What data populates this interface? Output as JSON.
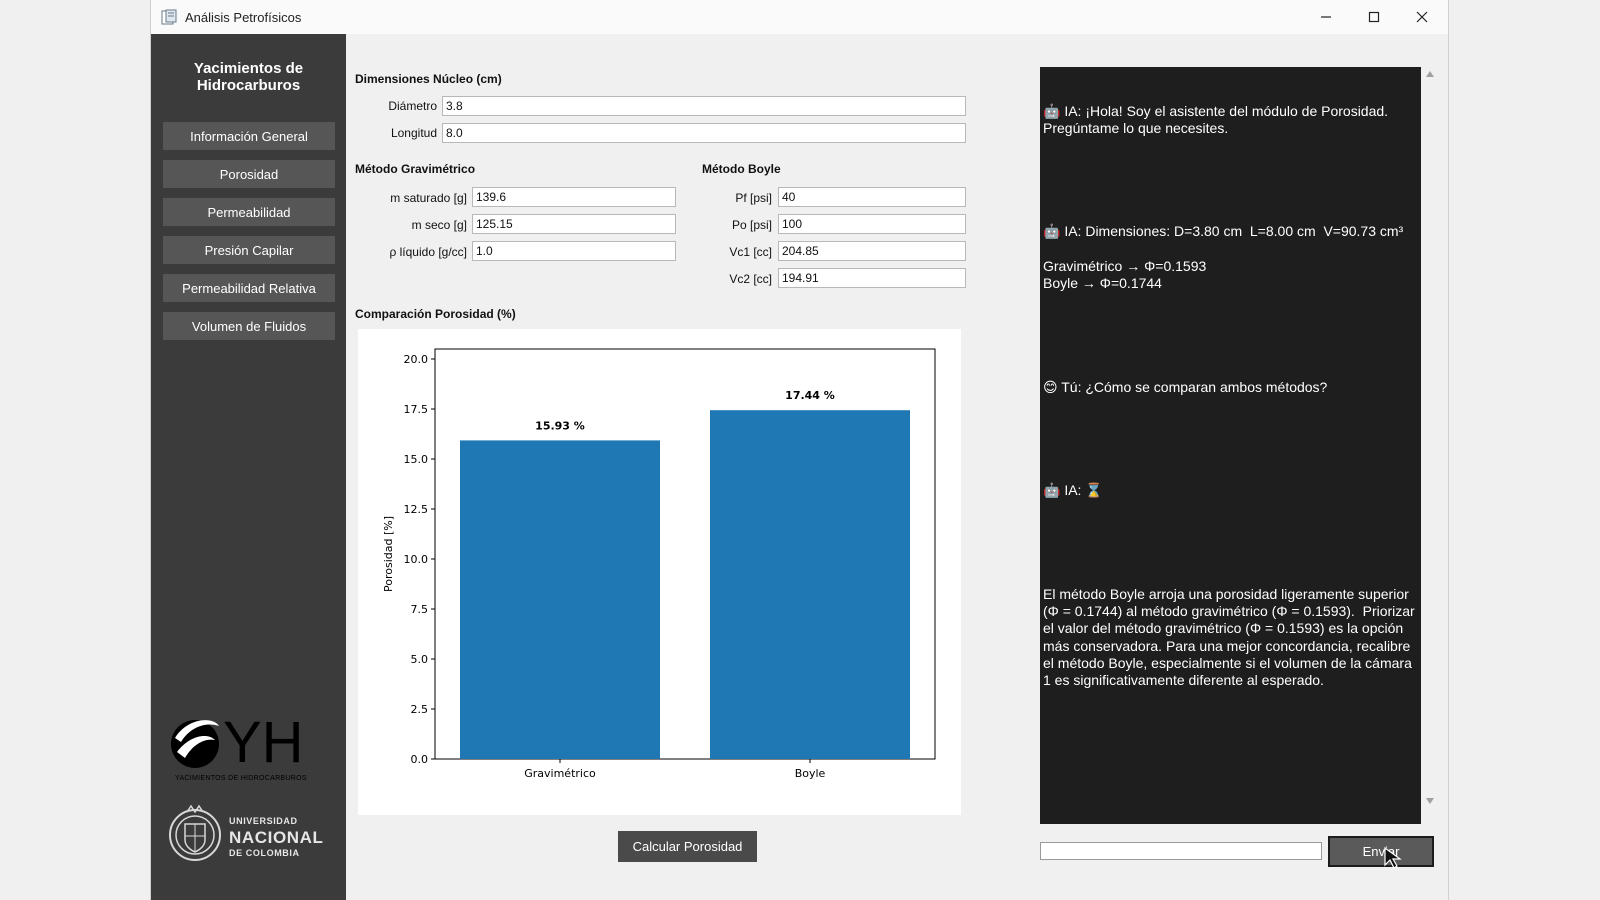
{
  "window": {
    "title": "Análisis Petrofísicos"
  },
  "sidebar": {
    "title_line1": "Yacimientos de",
    "title_line2": "Hidrocarburos",
    "items": [
      {
        "label": "Información General"
      },
      {
        "label": "Porosidad"
      },
      {
        "label": "Permeabilidad"
      },
      {
        "label": "Presión Capilar"
      },
      {
        "label": "Permeabilidad Relativa"
      },
      {
        "label": "Volumen de Fluidos"
      }
    ],
    "logo_yh": {
      "text": "YH",
      "caption": "YACIMIENTOS DE HIDROCARBUROS"
    },
    "logo_unal": {
      "line1": "UNIVERSIDAD",
      "line2": "NACIONAL",
      "line3": "DE COLOMBIA"
    }
  },
  "core": {
    "title": "Dimensiones Núcleo (cm)",
    "diameter_label": "Diámetro",
    "diameter_value": "3.8",
    "length_label": "Longitud",
    "length_value": "8.0"
  },
  "gravimetric": {
    "title": "Método Gravimétrico",
    "fields": [
      {
        "label": "m saturado [g]",
        "value": "139.6"
      },
      {
        "label": "m seco [g]",
        "value": "125.15"
      },
      {
        "label": "ρ líquido [g/cc]",
        "value": "1.0"
      }
    ]
  },
  "boyle": {
    "title": "Método Boyle",
    "fields": [
      {
        "label": "Pf [psi]",
        "value": "40"
      },
      {
        "label": "Po [psi]",
        "value": "100"
      },
      {
        "label": "Vc1 [cc]",
        "value": "204.85"
      },
      {
        "label": "Vc2 [cc]",
        "value": "194.91"
      }
    ]
  },
  "chart_section_title": "Comparación Porosidad (%)",
  "chart_data": {
    "type": "bar",
    "categories": [
      "Gravimétrico",
      "Boyle"
    ],
    "values": [
      15.93,
      17.44
    ],
    "data_labels": [
      "15.93 %",
      "17.44 %"
    ],
    "title": "",
    "xlabel": "",
    "ylabel": "Porosidad [%]",
    "ylim": [
      0,
      20.5
    ],
    "yticks": [
      "0.0",
      "2.5",
      "5.0",
      "7.5",
      "10.0",
      "12.5",
      "15.0",
      "17.5",
      "20.0"
    ],
    "grid": false,
    "bar_color": "#1f77b4"
  },
  "calculate_button": "Calcular Porosidad",
  "chat": {
    "messages": [
      {
        "text": "🤖 IA: ¡Hola! Soy el asistente del módulo de Porosidad. Pregúntame lo que necesites."
      },
      {
        "text": "🤖 IA: Dimensiones: D=3.80 cm  L=8.00 cm  V=90.73 cm³\n\nGravimétrico → Φ=0.1593\nBoyle → Φ=0.1744"
      },
      {
        "text": "😊 Tú: ¿Cómo se comparan ambos métodos?"
      },
      {
        "text": "🤖 IA: ⌛"
      },
      {
        "text": "El método Boyle arroja una porosidad ligeramente superior (Φ = 0.1744) al método gravimétrico (Φ = 0.1593).  Priorizar el valor del método gravimétrico (Φ = 0.1593) es la opción más conservadora. Para una mejor concordancia, recalibre el método Boyle, especialmente si el volumen de la cámara 1 es significativamente diferente al esperado."
      }
    ],
    "input_value": "",
    "send_label": "Enviar"
  }
}
